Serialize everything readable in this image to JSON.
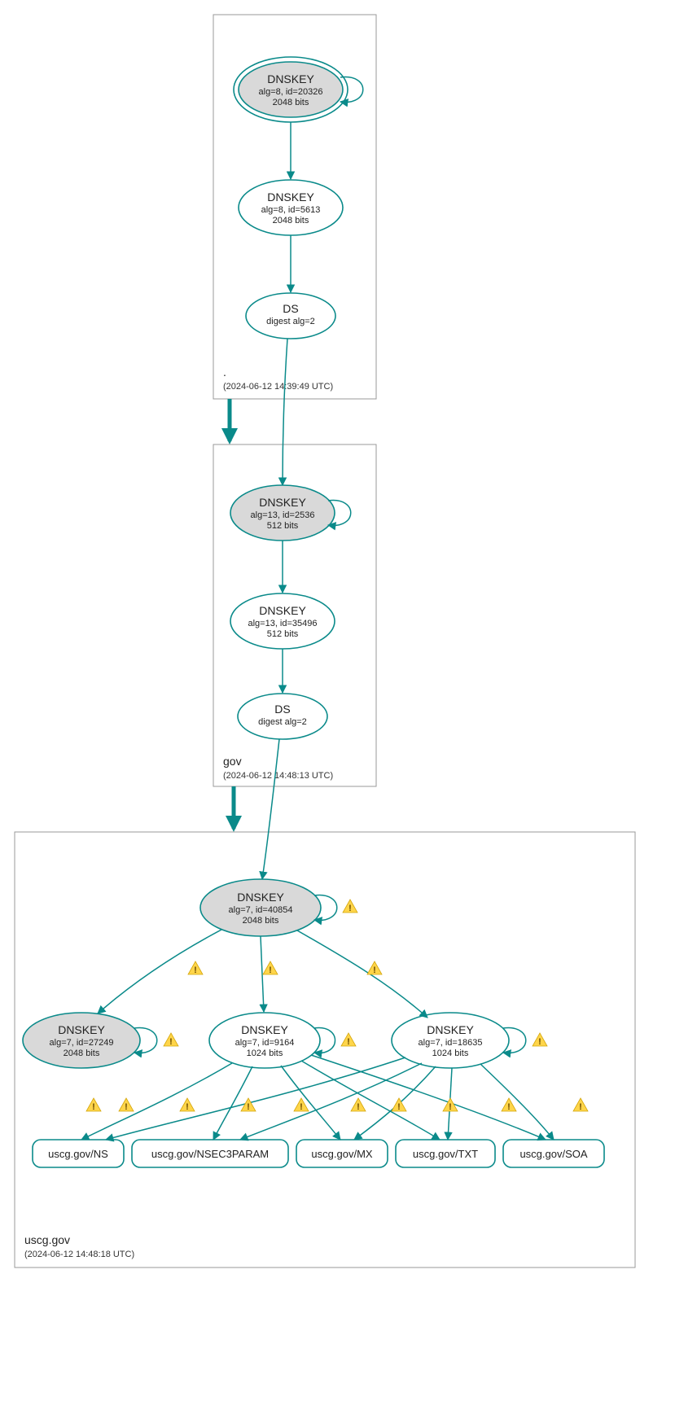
{
  "zones": {
    "root": {
      "name": ".",
      "timestamp": "(2024-06-12 14:39:49 UTC)"
    },
    "gov": {
      "name": "gov",
      "timestamp": "(2024-06-12 14:48:13 UTC)"
    },
    "uscg": {
      "name": "uscg.gov",
      "timestamp": "(2024-06-12 14:48:18 UTC)"
    }
  },
  "nodes": {
    "root_ksk": {
      "title": "DNSKEY",
      "line1": "alg=8, id=20326",
      "line2": "2048 bits"
    },
    "root_zsk": {
      "title": "DNSKEY",
      "line1": "alg=8, id=5613",
      "line2": "2048 bits"
    },
    "root_ds": {
      "title": "DS",
      "line1": "digest alg=2"
    },
    "gov_ksk": {
      "title": "DNSKEY",
      "line1": "alg=13, id=2536",
      "line2": "512 bits"
    },
    "gov_zsk": {
      "title": "DNSKEY",
      "line1": "alg=13, id=35496",
      "line2": "512 bits"
    },
    "gov_ds": {
      "title": "DS",
      "line1": "digest alg=2"
    },
    "uscg_ksk": {
      "title": "DNSKEY",
      "line1": "alg=7, id=40854",
      "line2": "2048 bits"
    },
    "uscg_k2": {
      "title": "DNSKEY",
      "line1": "alg=7, id=27249",
      "line2": "2048 bits"
    },
    "uscg_z1": {
      "title": "DNSKEY",
      "line1": "alg=7, id=9164",
      "line2": "1024 bits"
    },
    "uscg_z2": {
      "title": "DNSKEY",
      "line1": "alg=7, id=18635",
      "line2": "1024 bits"
    },
    "rr_ns": {
      "label": "uscg.gov/NS"
    },
    "rr_nsec3": {
      "label": "uscg.gov/NSEC3PARAM"
    },
    "rr_mx": {
      "label": "uscg.gov/MX"
    },
    "rr_txt": {
      "label": "uscg.gov/TXT"
    },
    "rr_soa": {
      "label": "uscg.gov/SOA"
    }
  }
}
